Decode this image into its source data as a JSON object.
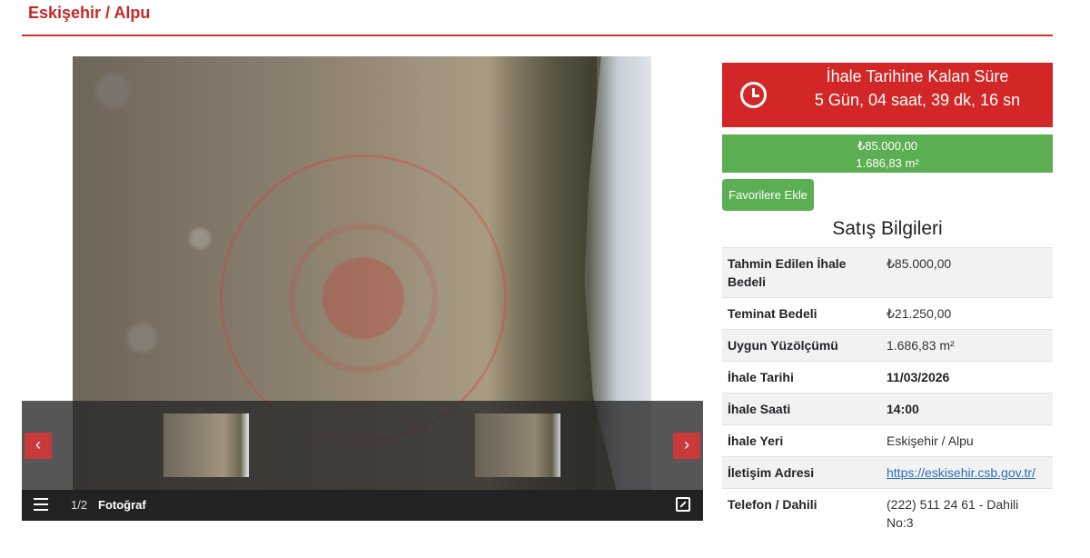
{
  "header": {
    "location": "Eskişehir / Alpu"
  },
  "gallery": {
    "prev_label": "‹",
    "next_label": "›",
    "counter": "1/2",
    "counter_label": "Fotoğraf"
  },
  "countdown": {
    "title": "İhale Tarihine Kalan Süre",
    "time": "5 Gün, 04 saat, 39 dk, 16 sn"
  },
  "price": {
    "amount": "₺85.000,00",
    "area": "1.686,83 m²"
  },
  "favorite_button": "Favorilere Ekle",
  "sales_info": {
    "title": "Satış Bilgileri",
    "rows": [
      {
        "label": "Tahmin Edilen İhale Bedeli",
        "value": "₺85.000,00"
      },
      {
        "label": "Teminat Bedeli",
        "value": "₺21.250,00"
      },
      {
        "label": "Uygun Yüzölçümü",
        "value": "1.686,83 m²"
      },
      {
        "label": "İhale Tarihi",
        "value": "11/03/2026"
      },
      {
        "label": "İhale Saati",
        "value": "14:00"
      },
      {
        "label": "İhale Yeri",
        "value": "Eskişehir / Alpu"
      },
      {
        "label": "İletişim Adresi",
        "value": "https://eskisehir.csb.gov.tr/"
      },
      {
        "label": "Telefon / Dahili",
        "value": "(222) 511 24 61 - Dahili No:3"
      }
    ]
  },
  "colors": {
    "accent_red": "#d32626",
    "accent_green": "#5cae52",
    "link": "#2a6db5"
  },
  "icons": [
    "clock-icon",
    "list-icon",
    "expand-icon",
    "chevron-left-icon",
    "chevron-right-icon"
  ]
}
